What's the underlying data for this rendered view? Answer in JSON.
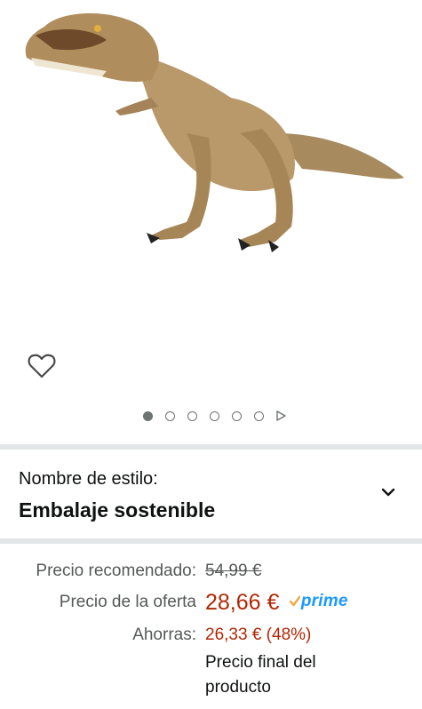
{
  "product": {
    "image_alt": "Jurassic World T-Rex figure",
    "image_name": "t-rex-figure"
  },
  "actions": {
    "wishlist_icon": "heart-outline-icon"
  },
  "carousel": {
    "total_images": 6,
    "active_index": 0,
    "has_video": true,
    "video_icon": "play-icon"
  },
  "style": {
    "label": "Nombre de estilo:",
    "value": "Embalaje sostenible",
    "chevron_icon": "chevron-down-icon"
  },
  "pricing": {
    "list_price_label": "Precio recomendado:",
    "list_price": "54,99 €",
    "deal_price_label": "Precio de la oferta",
    "deal_price": "28,66 €",
    "prime_label": "prime",
    "savings_label": "Ahorras:",
    "savings": "26,33 € (48%)",
    "final_note": "Precio final del producto"
  },
  "colors": {
    "price_red": "#b12704",
    "prime_blue": "#1a98ff",
    "divider_gray": "#e3e6e6",
    "secondary_text": "#565959"
  }
}
